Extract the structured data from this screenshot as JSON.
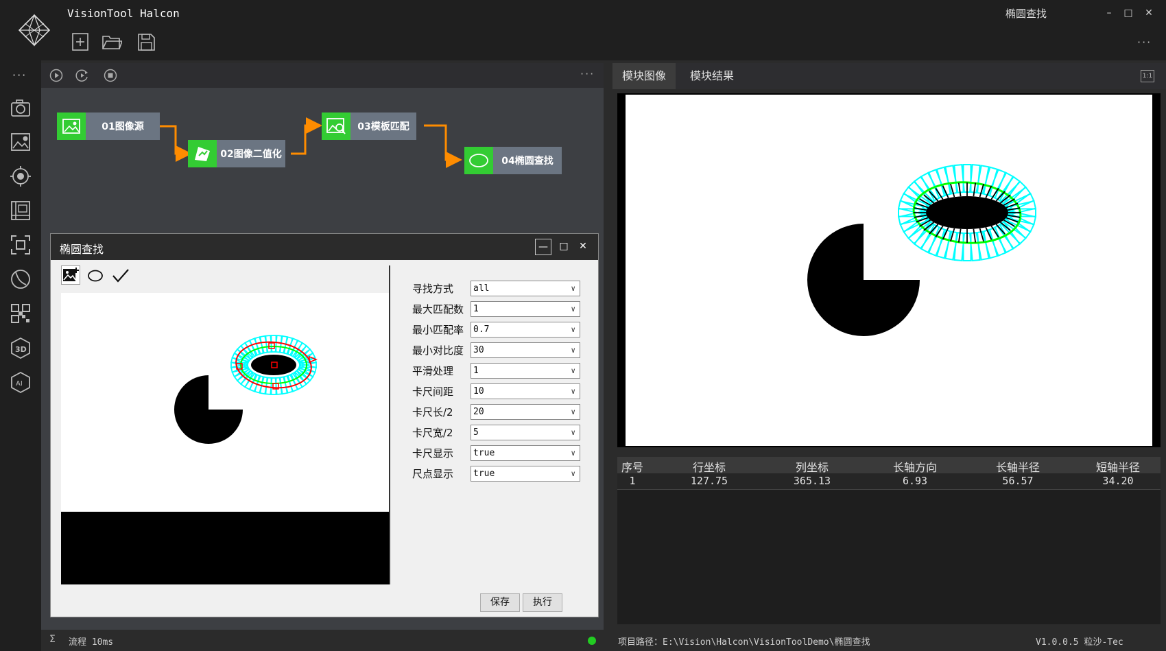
{
  "app": {
    "title": "VisionTool Halcon",
    "module_name": "椭圆查找",
    "more": "···"
  },
  "window": {
    "minimize": "–",
    "maximize": "□",
    "close": "✕"
  },
  "toolbar": {
    "icons": [
      "new-file-icon",
      "open-folder-icon",
      "save-icon"
    ]
  },
  "sidebar": {
    "more": "···",
    "icons": [
      "camera-icon",
      "image-settings-icon",
      "target-icon",
      "gallery-icon",
      "focus-icon",
      "curve-icon",
      "qr-code-icon",
      "3d-icon",
      "ai-icon"
    ],
    "ai_label": "AI",
    "three_d_label": "3D"
  },
  "flow": {
    "controls": [
      "run-icon",
      "loop-run-icon",
      "stop-icon"
    ],
    "more": "···",
    "nodes": [
      {
        "label": "01图像源",
        "icon": "image-icon"
      },
      {
        "label": "02图像二值化",
        "icon": "binarize-icon"
      },
      {
        "label": "03模板匹配",
        "icon": "template-match-icon"
      },
      {
        "label": "04椭圆查找",
        "icon": "ellipse-icon"
      }
    ],
    "accent": "#33cc33",
    "connector": "#ff8c00"
  },
  "dialog": {
    "title": "椭圆查找",
    "tools": [
      "image-add-icon",
      "ellipse-tool-icon",
      "check-icon"
    ],
    "params": [
      {
        "label": "寻找方式",
        "value": "all"
      },
      {
        "label": "最大匹配数",
        "value": "1"
      },
      {
        "label": "最小匹配率",
        "value": "0.7"
      },
      {
        "label": "最小对比度",
        "value": "30"
      },
      {
        "label": "平滑处理",
        "value": "1"
      },
      {
        "label": "卡尺间距",
        "value": "10"
      },
      {
        "label": "卡尺长/2",
        "value": "20"
      },
      {
        "label": "卡尺宽/2",
        "value": "5"
      },
      {
        "label": "卡尺显示",
        "value": "true"
      },
      {
        "label": "尺点显示",
        "value": "true"
      }
    ],
    "save": "保存",
    "execute": "执行"
  },
  "right": {
    "tabs": [
      "模块图像",
      "模块结果"
    ],
    "fit_label": "1:1",
    "table": {
      "headers": [
        "序号",
        "行坐标",
        "列坐标",
        "长轴方向",
        "长轴半径",
        "短轴半径"
      ],
      "rows": [
        [
          "1",
          "127.75",
          "365.13",
          "6.93",
          "56.57",
          "34.20"
        ]
      ]
    }
  },
  "status": {
    "sigma": "Σ",
    "flow_time": "流程 10ms",
    "project_path": "项目路径：E:\\Vision\\Halcon\\VisionToolDemo\\椭圆查找",
    "version": "V1.0.0.5 粒沙-Tec",
    "status_color": "#22cc22"
  }
}
